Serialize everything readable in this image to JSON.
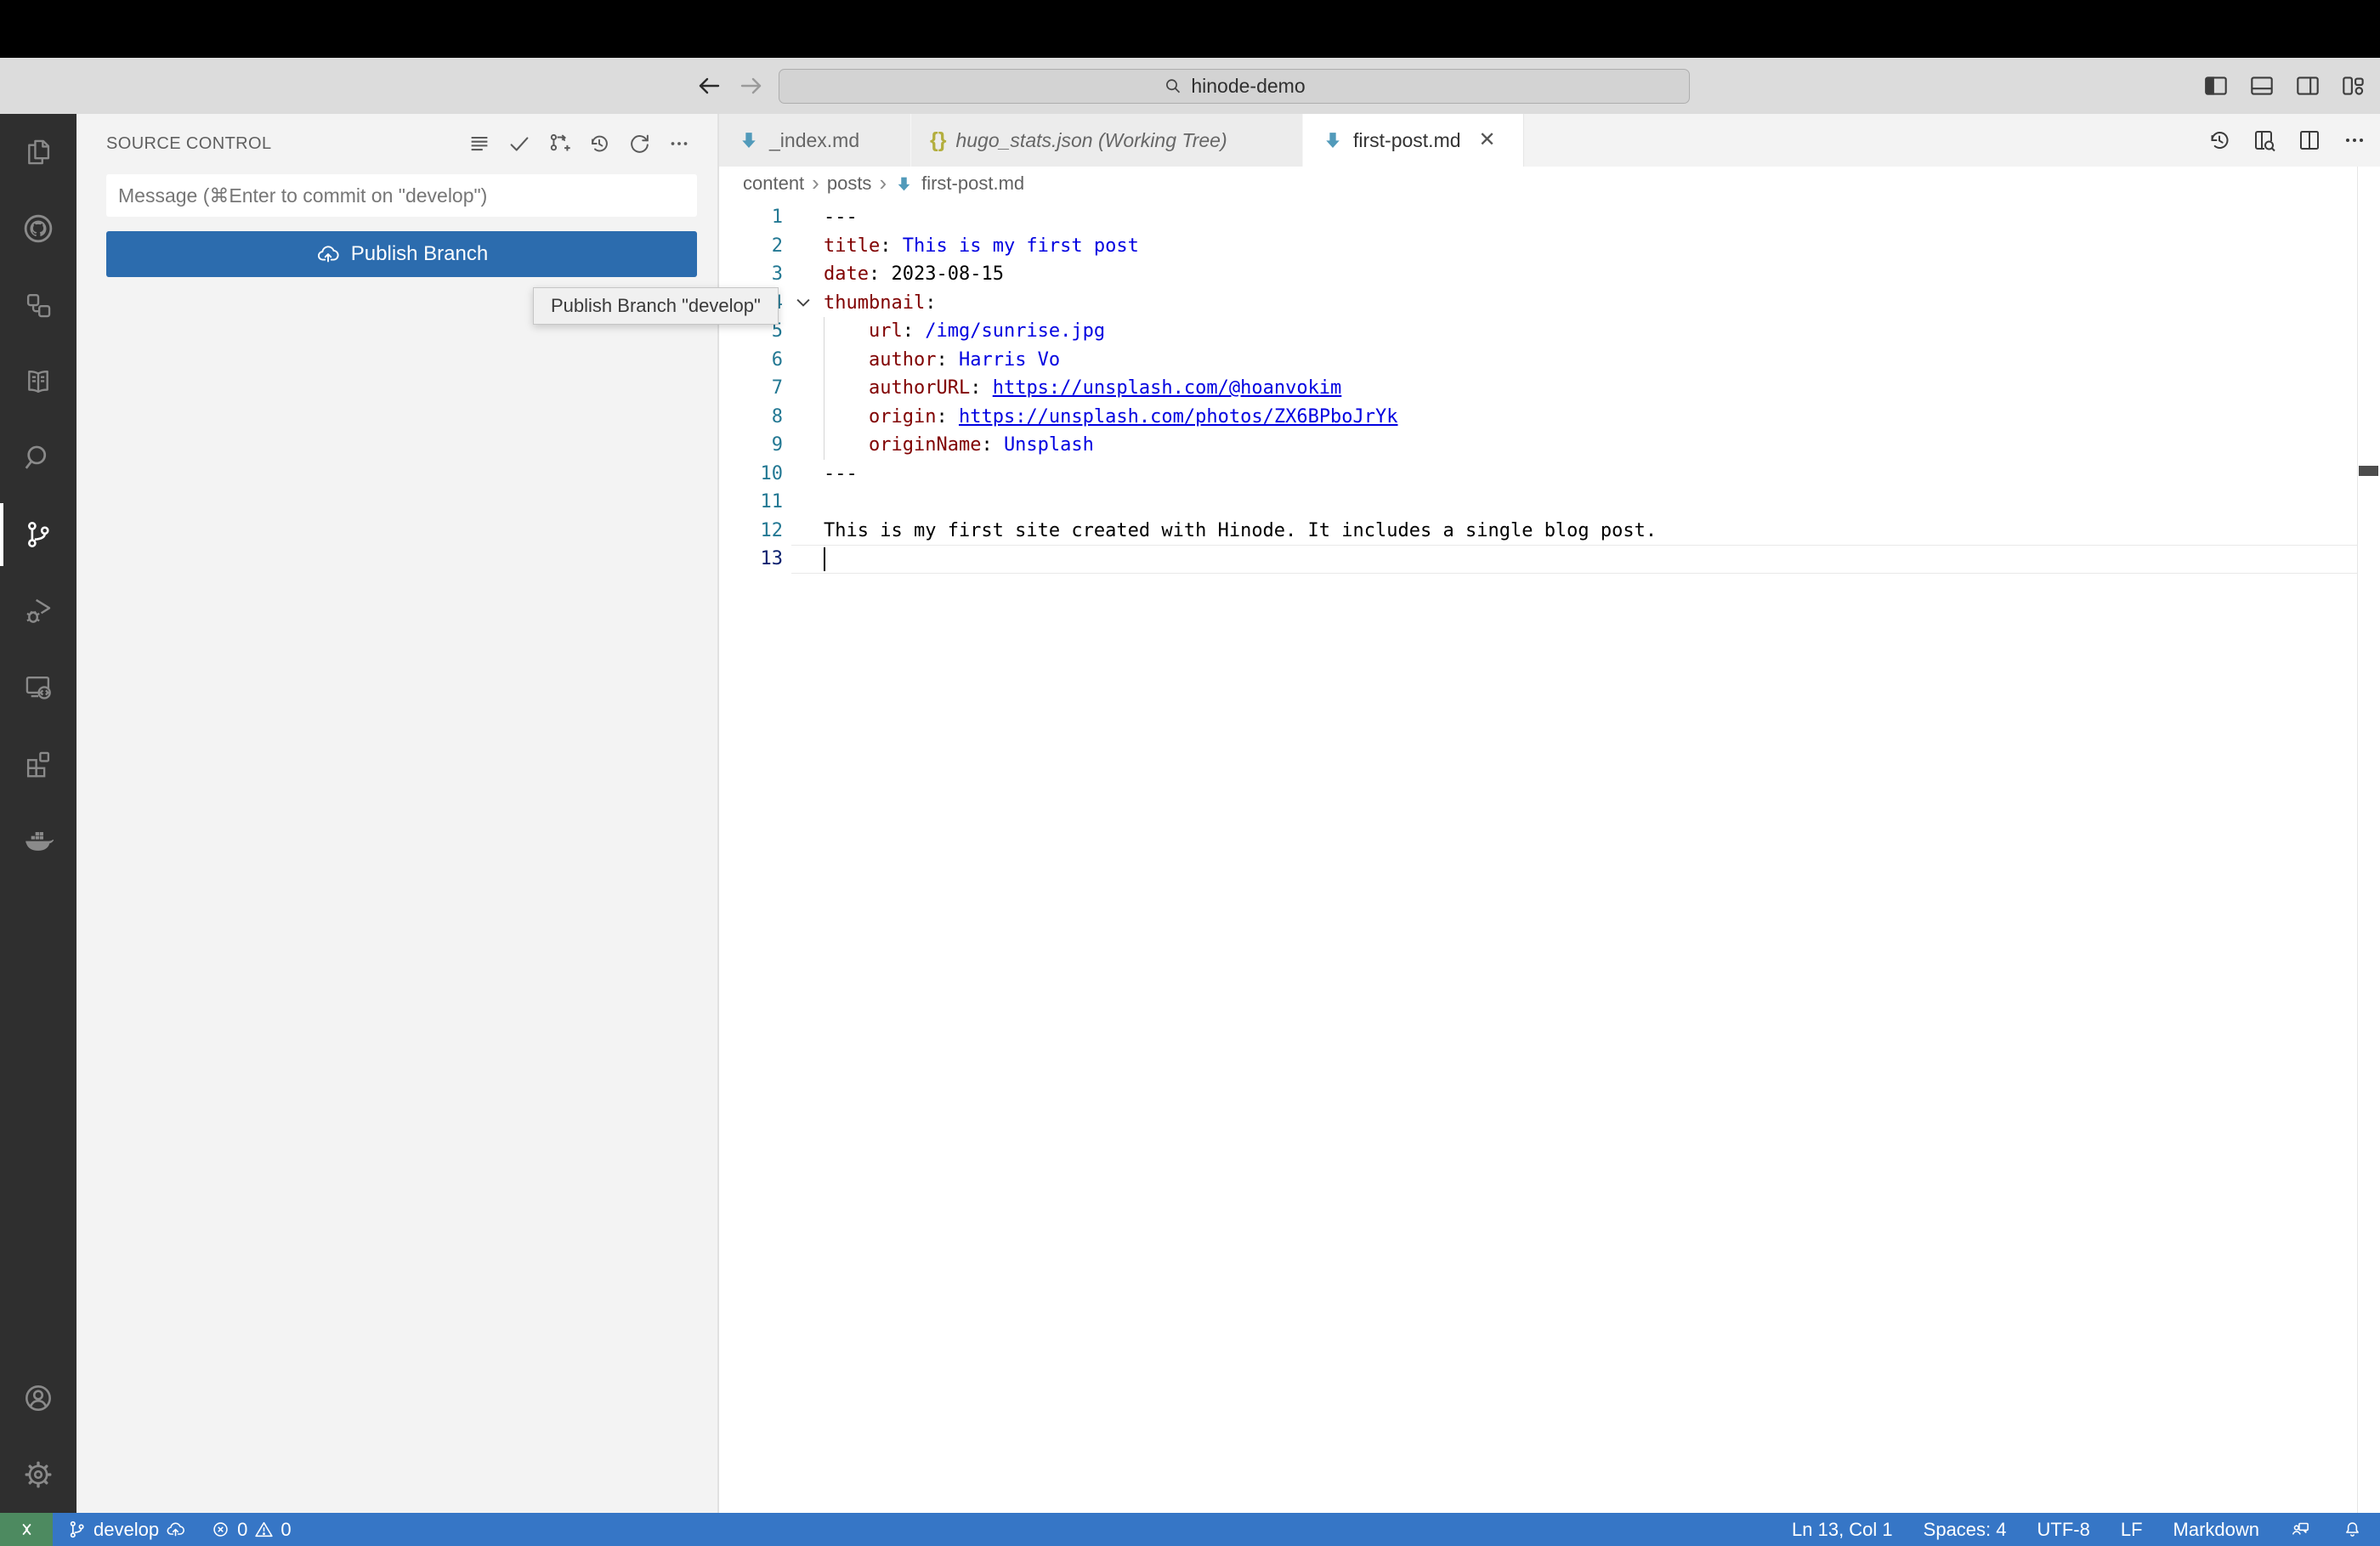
{
  "titlebar": {
    "command_center_text": "hinode-demo",
    "window_controls": [
      "toggle-primary-sidebar",
      "toggle-panel",
      "toggle-secondary-sidebar",
      "customize-layout"
    ]
  },
  "activity_bar": {
    "items": [
      {
        "name": "explorer",
        "active": false
      },
      {
        "name": "github",
        "active": false
      },
      {
        "name": "connections",
        "active": false
      },
      {
        "name": "docs",
        "active": false
      },
      {
        "name": "search",
        "active": false
      },
      {
        "name": "source-control",
        "active": true
      },
      {
        "name": "run-debug",
        "active": false
      },
      {
        "name": "remote-explorer",
        "active": false
      },
      {
        "name": "extensions",
        "active": false
      },
      {
        "name": "docker",
        "active": false
      }
    ],
    "bottom_items": [
      {
        "name": "accounts"
      },
      {
        "name": "settings"
      }
    ]
  },
  "sidebar": {
    "title": "SOURCE CONTROL",
    "toolbar_icons": [
      "view-as-list",
      "commit",
      "create-branch",
      "history",
      "refresh",
      "more-actions"
    ],
    "message_placeholder": "Message (⌘Enter to commit on \"develop\")",
    "publish_button_label": "Publish Branch",
    "tooltip": "Publish Branch \"develop\""
  },
  "editor": {
    "tabs": [
      {
        "label": "_index.md",
        "icon": "markdown",
        "active": false,
        "preview": false
      },
      {
        "label": "hugo_stats.json (Working Tree)",
        "icon": "json",
        "active": false,
        "preview": true
      },
      {
        "label": "first-post.md",
        "icon": "markdown",
        "active": true,
        "preview": false,
        "closable": true
      }
    ],
    "toolbar_icons": [
      "timeline",
      "open-preview",
      "split-editor",
      "more-actions"
    ],
    "breadcrumb": {
      "items": [
        "content",
        "posts"
      ],
      "file": "first-post.md"
    },
    "code": {
      "active_line": 13,
      "lines": [
        {
          "n": 1,
          "segs": [
            [
              "pl",
              "---"
            ]
          ]
        },
        {
          "n": 2,
          "segs": [
            [
              "key",
              "title"
            ],
            [
              "pl",
              ": "
            ],
            [
              "str",
              "This is my first post"
            ]
          ]
        },
        {
          "n": 3,
          "segs": [
            [
              "key",
              "date"
            ],
            [
              "pl",
              ": "
            ],
            [
              "pl",
              "2023-08-15"
            ]
          ]
        },
        {
          "n": 4,
          "fold": true,
          "segs": [
            [
              "key",
              "thumbnail"
            ],
            [
              "pl",
              ":"
            ]
          ]
        },
        {
          "n": 5,
          "segs": [
            [
              "pl",
              "    "
            ],
            [
              "key",
              "url"
            ],
            [
              "pl",
              ": "
            ],
            [
              "str",
              "/img/sunrise.jpg"
            ]
          ]
        },
        {
          "n": 6,
          "segs": [
            [
              "pl",
              "    "
            ],
            [
              "key",
              "author"
            ],
            [
              "pl",
              ": "
            ],
            [
              "str",
              "Harris Vo"
            ]
          ]
        },
        {
          "n": 7,
          "segs": [
            [
              "pl",
              "    "
            ],
            [
              "key",
              "authorURL"
            ],
            [
              "pl",
              ": "
            ],
            [
              "link",
              "https://unsplash.com/@hoanvokim"
            ]
          ]
        },
        {
          "n": 8,
          "segs": [
            [
              "pl",
              "    "
            ],
            [
              "key",
              "origin"
            ],
            [
              "pl",
              ": "
            ],
            [
              "link",
              "https://unsplash.com/photos/ZX6BPboJrYk"
            ]
          ]
        },
        {
          "n": 9,
          "segs": [
            [
              "pl",
              "    "
            ],
            [
              "key",
              "originName"
            ],
            [
              "pl",
              ": "
            ],
            [
              "str",
              "Unsplash"
            ]
          ]
        },
        {
          "n": 10,
          "segs": [
            [
              "pl",
              "---"
            ]
          ]
        },
        {
          "n": 11,
          "segs": []
        },
        {
          "n": 12,
          "segs": [
            [
              "pl",
              "This is my first site created with Hinode. It includes a single blog post."
            ]
          ]
        },
        {
          "n": 13,
          "cursor": true,
          "segs": []
        }
      ]
    }
  },
  "status_bar": {
    "remote_indicator": "open-remote-window",
    "branch": "develop",
    "errors": "0",
    "warnings": "0",
    "cursor_position": "Ln 13, Col 1",
    "indentation": "Spaces: 4",
    "encoding": "UTF-8",
    "eol": "LF",
    "language_mode": "Markdown"
  },
  "colors": {
    "publish_button_bg": "#2c6cae",
    "statusbar_bg": "#3676c6",
    "remote_indicator_bg": "#4d8a60",
    "markdown_icon": "#519aba",
    "json_icon": "#b3ae3e",
    "yaml_key": "#800000",
    "yaml_value": "#0000e0",
    "line_number": "#237893",
    "activity_bar_bg": "#2f2f2f",
    "titlebar_bg": "#dcdcdc"
  }
}
